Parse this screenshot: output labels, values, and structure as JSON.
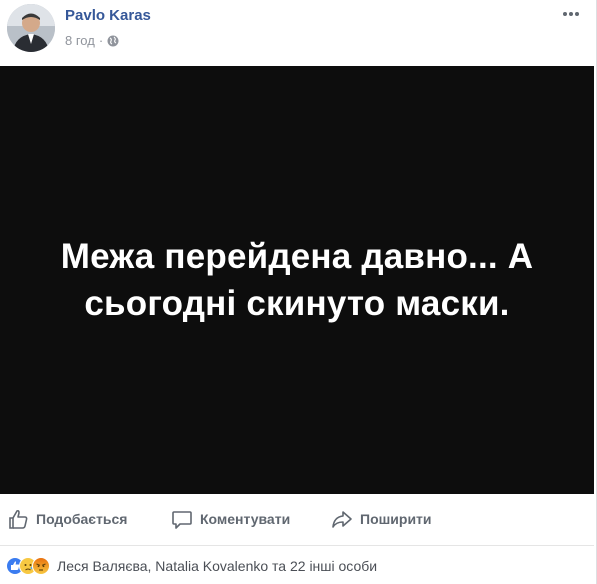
{
  "post": {
    "author": "Pavlo Karas",
    "time": "8 год",
    "separator": "·",
    "audience_icon": "globe-icon",
    "media_text": "Межа перейдена давно... А сьогодні скинуто маски."
  },
  "actions": {
    "like": "Подобається",
    "comment": "Коментувати",
    "share": "Поширити"
  },
  "reactions": {
    "icons": [
      "like-icon",
      "sad-icon",
      "angry-icon"
    ],
    "summary": "Леся Валяєва, Natalia Kovalenko та 22 інші особи"
  },
  "colors": {
    "author_link": "#365899",
    "action_text": "#606770",
    "media_bg": "#0d0d0d"
  }
}
